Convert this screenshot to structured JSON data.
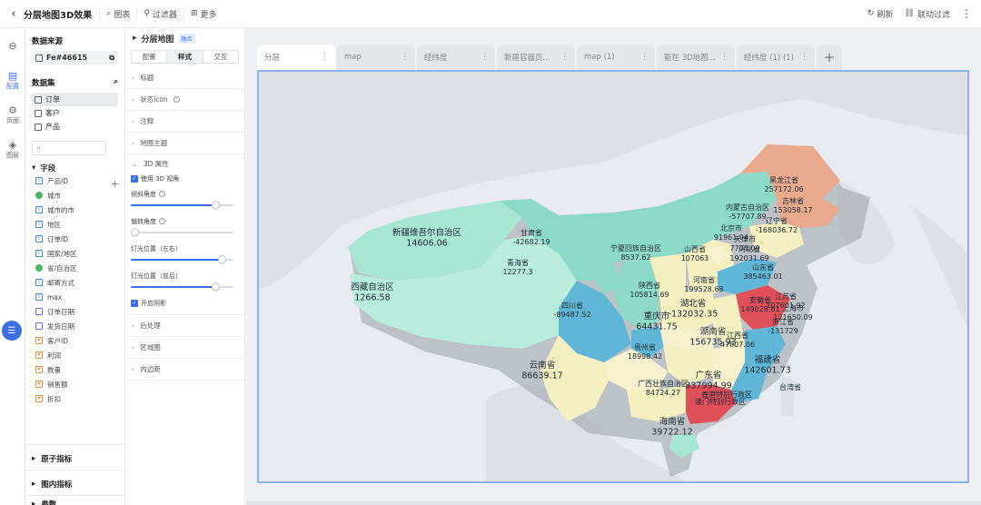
{
  "topbar": {
    "title": "分层地图3D效果",
    "chart_btn": "图表",
    "filter_btn": "过滤器",
    "more_btn": "更多",
    "refresh": "刷新",
    "linked_filter": "联动过滤"
  },
  "rail": {
    "config": "配置",
    "page": "页面",
    "layer": "图层"
  },
  "datapanel": {
    "source_heading": "数据来源",
    "source_name": "Fe#46615",
    "dataset_heading": "数据集",
    "datasets": [
      "订单",
      "客户",
      "产品"
    ],
    "fields_heading": "字段",
    "fields": [
      {
        "name": "产品ID",
        "kind": "t"
      },
      {
        "name": "城市",
        "kind": "geo"
      },
      {
        "name": "城市的市",
        "kind": "t"
      },
      {
        "name": "地区",
        "kind": "t"
      },
      {
        "name": "订单ID",
        "kind": "t"
      },
      {
        "name": "国家/地区",
        "kind": "t"
      },
      {
        "name": "省/自治区",
        "kind": "geo"
      },
      {
        "name": "邮寄方式",
        "kind": "t"
      },
      {
        "name": "max",
        "kind": "t"
      },
      {
        "name": "订单日期",
        "kind": "date"
      },
      {
        "name": "发货日期",
        "kind": "date"
      },
      {
        "name": "客户ID",
        "kind": "num"
      },
      {
        "name": "利润",
        "kind": "num"
      },
      {
        "name": "数量",
        "kind": "num"
      },
      {
        "name": "销售额",
        "kind": "num"
      },
      {
        "name": "折扣",
        "kind": "num"
      }
    ],
    "sections": [
      "原子指标",
      "图内指标",
      "参数"
    ]
  },
  "cfgpanel": {
    "title": "分层地图",
    "badge": "融合",
    "tabs": [
      "配置",
      "样式",
      "交互"
    ],
    "items_top": [
      "标题",
      "状态icon",
      "注释",
      "地图主题"
    ],
    "section_3d": "3D 属性",
    "use_3d": "使用 3D 视角",
    "sliders": [
      {
        "label": "倾斜角度",
        "value": 0.82
      },
      {
        "label": "偏转角度",
        "value": 0.0
      },
      {
        "label": "灯光位置（左右）",
        "value": 0.88
      },
      {
        "label": "灯光位置（前后）",
        "value": 0.82
      }
    ],
    "shadow": "开启阴影",
    "items_bottom": [
      "后处理",
      "区域图",
      "内边距"
    ]
  },
  "canvas": {
    "tabs": [
      "分层",
      "map",
      "经纬度",
      "新建容器页...",
      "map (1)",
      "能在 3D地图...",
      "经纬度 (1) (1)"
    ],
    "add": "+"
  },
  "map": {
    "colors": {
      "teal": "#8cd9c8",
      "tealLight": "#b7ecdc",
      "blue": "#5fb6d6",
      "yellow": "#f4efc0",
      "salmon": "#e8a98c",
      "red": "#e0505a",
      "lightYellow": "#f7f1cf"
    },
    "labels": [
      {
        "name": "新疆维吾尔自治区",
        "value": "14606.06"
      },
      {
        "name": "西藏自治区",
        "value": "1266.58"
      },
      {
        "name": "青海省",
        "value": "12277.3"
      },
      {
        "name": "甘肃省",
        "value": "-42682.19"
      },
      {
        "name": "四川省",
        "value": "-89487.52"
      },
      {
        "name": "云南省",
        "value": "86639.17"
      },
      {
        "name": "宁夏回族自治区",
        "value": "8537.62"
      },
      {
        "name": "内蒙古自治区",
        "value": "-57707.89"
      },
      {
        "name": "黑龙江省",
        "value": "257172.06"
      },
      {
        "name": "吉林省",
        "value": "153058.17"
      },
      {
        "name": "辽宁省",
        "value": "-168036.72"
      },
      {
        "name": "北京市",
        "value": "91961.94"
      },
      {
        "name": "天津市",
        "value": "7704.09"
      },
      {
        "name": "河北省",
        "value": "192031.69"
      },
      {
        "name": "山西省",
        "value": "107063"
      },
      {
        "name": "山东省",
        "value": "385463.01"
      },
      {
        "name": "陕西省",
        "value": "105814.69"
      },
      {
        "name": "河南省",
        "value": "199528.68"
      },
      {
        "name": "安徽省",
        "value": "149028.61"
      },
      {
        "name": "江苏省",
        "value": "107601.92"
      },
      {
        "name": "上海市",
        "value": "121650.09"
      },
      {
        "name": "浙江省",
        "value": "-131729"
      },
      {
        "name": "湖北省",
        "value": "-132032.35"
      },
      {
        "name": "重庆市",
        "value": "64431.75"
      },
      {
        "name": "贵州省",
        "value": "18998.42"
      },
      {
        "name": "湖南省",
        "value": "156735.93"
      },
      {
        "name": "江西省",
        "value": "47807.06"
      },
      {
        "name": "福建省",
        "value": "142601.73"
      },
      {
        "name": "广西壮族自治区",
        "value": "84724.27"
      },
      {
        "name": "广东省",
        "value": "337994.99"
      },
      {
        "name": "澳门特别行政区",
        "value": ""
      },
      {
        "name": "香港特别行政区",
        "value": ""
      },
      {
        "name": "台湾省",
        "value": ""
      },
      {
        "name": "海南省",
        "value": "39722.12"
      }
    ]
  }
}
